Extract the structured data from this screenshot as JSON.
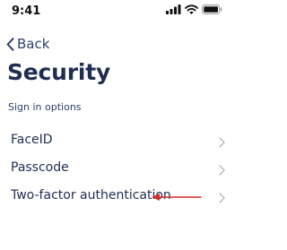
{
  "status_bar": {
    "time": "9:41",
    "icons": [
      "signal-icon",
      "wifi-icon",
      "battery-icon"
    ]
  },
  "nav": {
    "back_label": "Back",
    "back_icon": "chevron-left-icon"
  },
  "page": {
    "title": "Security",
    "section_label": "Sign in options"
  },
  "options": [
    {
      "label": "FaceID",
      "icon": "chevron-right-icon"
    },
    {
      "label": "Passcode",
      "icon": "chevron-right-icon"
    },
    {
      "label": "Two-factor authentication",
      "icon": "chevron-right-icon",
      "annotation": "red-arrow-icon"
    }
  ],
  "colors": {
    "text": "#1f2d52",
    "accent": "#2c3f6b",
    "annotation": "#d42a2a",
    "chevron": "#b8b8b8"
  }
}
